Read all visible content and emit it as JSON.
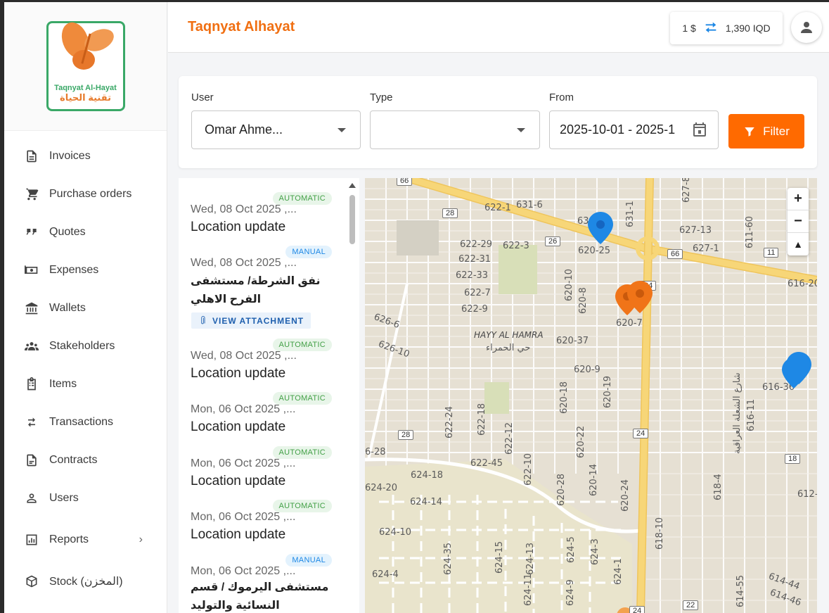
{
  "brand": {
    "title": "Taqnyat Alhayat",
    "logo_en": "Taqnyat Al-Hayat",
    "logo_ar": "تقنية الحياة"
  },
  "header": {
    "rate_left": "1 $",
    "rate_right": "1,390 IQD"
  },
  "sidebar": {
    "items": [
      {
        "label": "Invoices",
        "icon": "invoice-icon"
      },
      {
        "label": "Purchase orders",
        "icon": "cart-icon"
      },
      {
        "label": "Quotes",
        "icon": "quote-icon"
      },
      {
        "label": "Expenses",
        "icon": "cash-icon"
      },
      {
        "label": "Wallets",
        "icon": "bank-icon"
      },
      {
        "label": "Stakeholders",
        "icon": "group-icon"
      },
      {
        "label": "Items",
        "icon": "clipboard-icon"
      },
      {
        "label": "Transactions",
        "icon": "swap-icon"
      },
      {
        "label": "Contracts",
        "icon": "document-icon"
      },
      {
        "label": "Users",
        "icon": "user-icon"
      },
      {
        "label": "Reports",
        "icon": "chart-icon"
      },
      {
        "label": "Stock (المخزن)",
        "icon": "box-icon"
      }
    ]
  },
  "filters": {
    "user_label": "User",
    "user_value": "Omar Ahme...",
    "type_label": "Type",
    "type_value": "",
    "from_label": "From",
    "from_value": "2025-10-01 - 2025-1",
    "filter_button": "Filter"
  },
  "list": {
    "attachment_label": "VIEW ATTACHMENT",
    "items": [
      {
        "badge": "AUTOMATIC",
        "date": "Wed, 08 Oct 2025 ,...",
        "title": "Location update"
      },
      {
        "badge": "MANUAL",
        "date": "Wed, 08 Oct 2025 ,...",
        "title": "نفق الشرطة/ مستشفى الفرح الاهلي"
      },
      {
        "badge": "AUTOMATIC",
        "date": "Wed, 08 Oct 2025 ,...",
        "title": "Location update"
      },
      {
        "badge": "AUTOMATIC",
        "date": "Mon, 06 Oct 2025 ,...",
        "title": "Location update"
      },
      {
        "badge": "AUTOMATIC",
        "date": "Mon, 06 Oct 2025 ,...",
        "title": "Location update"
      },
      {
        "badge": "AUTOMATIC",
        "date": "Mon, 06 Oct 2025 ,...",
        "title": "Location update"
      },
      {
        "badge": "MANUAL",
        "date": "Mon, 06 Oct 2025 ,...",
        "title": "مستشفى اليرموك / قسم النسائية والتوليد"
      }
    ]
  },
  "map": {
    "zoom_in": "+",
    "zoom_out": "−",
    "compass": "▲",
    "district_en": "HAYY AL HAMRA",
    "district_ar": "حي الحمراء",
    "street_ar": "شارع الشعلة العراقية",
    "labels": [
      "622-1",
      "631-6",
      "622-29",
      "622-3",
      "622-31",
      "622-33",
      "622-7",
      "622-9",
      "626-6",
      "626-10",
      "620-25",
      "620-10",
      "620-8",
      "620-7",
      "620-37",
      "620-9",
      "620-18",
      "620-19",
      "620-22",
      "620-14",
      "620-28",
      "620-24",
      "622-24",
      "622-18",
      "622-12",
      "622-45",
      "622-10",
      "624-18",
      "624-14",
      "624-20",
      "624-10",
      "624-35",
      "624-15",
      "624-13",
      "624-5",
      "624-3",
      "624-11",
      "624-9",
      "624-1",
      "624-4",
      "627-8",
      "627-13",
      "627-1",
      "631-1",
      "611-60",
      "616-20",
      "616-36",
      "616-11",
      "618-4",
      "618-10",
      "614-44",
      "614-46",
      "614-55",
      "612-",
      "61",
      "6-28",
      "63"
    ],
    "shields": [
      "66",
      "28",
      "26",
      "24",
      "66",
      "11",
      "24",
      "28",
      "24",
      "18",
      "22",
      "24"
    ],
    "colors": {
      "blue_pin": "#1e88e5",
      "orange_pin": "#f07418",
      "main_road": "#f7d678"
    }
  },
  "colors": {
    "accent": "#ff6a00",
    "brand": "#f06f12"
  }
}
